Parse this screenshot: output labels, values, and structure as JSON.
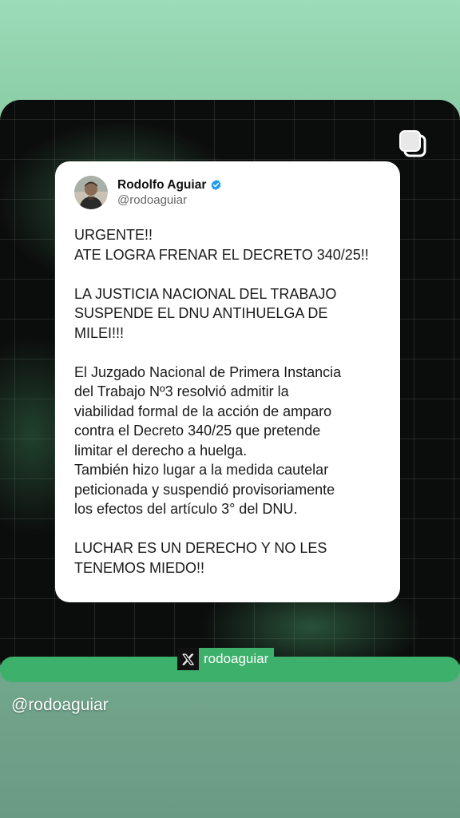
{
  "tweet": {
    "display_name": "Rodolfo Aguiar",
    "handle": "@rodoaguiar",
    "verified": true,
    "paragraphs": [
      "URGENTE!!\nATE LOGRA FRENAR EL DECRETO 340/25!!",
      "LA JUSTICIA NACIONAL DEL TRABAJO\nSUSPENDE EL DNU ANTIHUELGA DE\nMILEI!!!",
      "El Juzgado Nacional de Primera Instancia\ndel Trabajo Nº3 resolvió admitir la\nviabilidad formal de la acción de amparo\ncontra el Decreto 340/25 que pretende\nlimitar el derecho a huelga.\nTambién hizo lugar a la medida cautelar\npeticionada y suspendió provisoriamente\nlos efectos del artículo 3° del DNU.",
      "LUCHAR ES UN DERECHO Y NO LES\nTENEMOS MIEDO!!"
    ]
  },
  "source_tag": {
    "icon": "x-logo-icon",
    "handle": "rodoaguiar"
  },
  "caption": {
    "mention": "@rodoaguiar"
  },
  "icons": {
    "corner": "square-stack-icon",
    "verified": "verified-badge-icon",
    "avatar": "avatar"
  },
  "colors": {
    "background_top": "#9cdcb8",
    "background_bottom": "#6b9a84",
    "card_background": "#0b0c0c",
    "accent_green": "#3db06b",
    "verified_blue": "#1d9bf0"
  }
}
